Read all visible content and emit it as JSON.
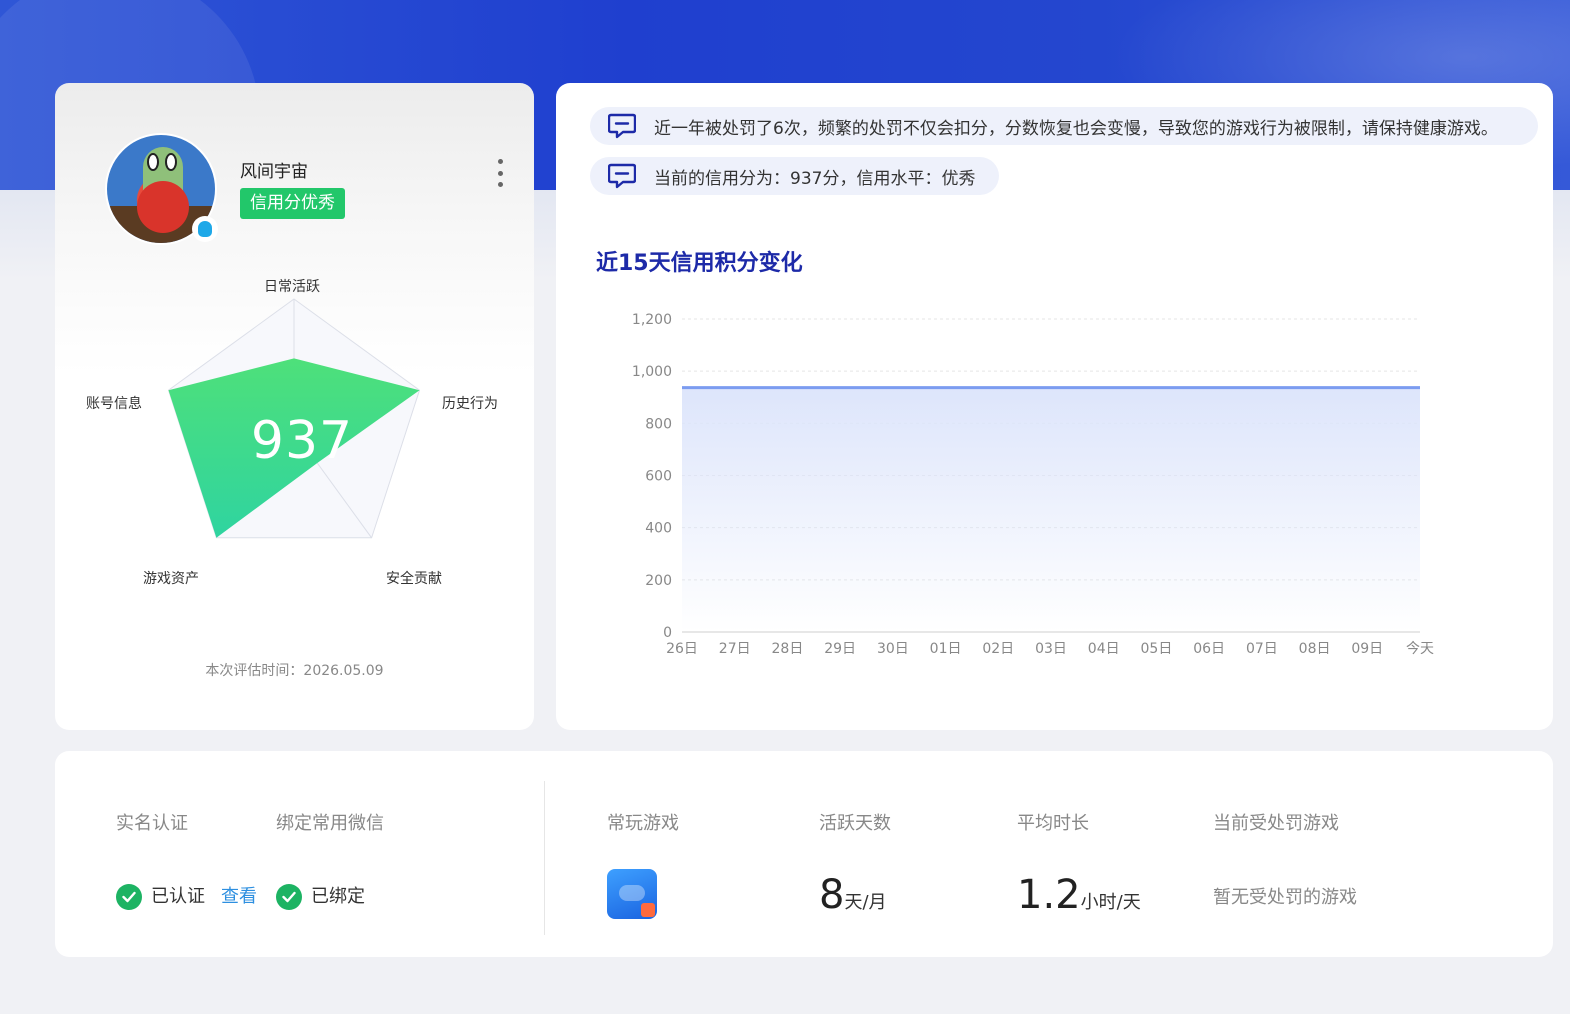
{
  "profile": {
    "nickname": "风间宇宙",
    "credit_badge": "信用分优秀",
    "score": "937",
    "radar_labels": {
      "daily": "日常活跃",
      "history": "历史行为",
      "security": "安全贡献",
      "assets": "游戏资产",
      "account": "账号信息"
    },
    "radar_values": {
      "daily": 0.55,
      "history": 1.0,
      "security": 0.3,
      "assets": 1.0,
      "account": 1.0
    },
    "eval_time": "本次评估时间：2026.05.09"
  },
  "notices": [
    "近一年被处罚了6次，频繁的处罚不仅会扣分，分数恢复也会变慢，导致您的游戏行为被限制，请保持健康游戏。",
    "当前的信用分为：937分，信用水平：优秀"
  ],
  "chart_data": {
    "type": "area",
    "title": "近15天信用积分变化",
    "x": [
      "26日",
      "27日",
      "28日",
      "29日",
      "30日",
      "01日",
      "02日",
      "03日",
      "04日",
      "05日",
      "06日",
      "07日",
      "08日",
      "09日",
      "今天"
    ],
    "y_tick_labels": [
      "0",
      "200",
      "400",
      "600",
      "800",
      "1,000",
      "1,200"
    ],
    "series": [
      {
        "values": [
          937,
          937,
          937,
          937,
          937,
          937,
          937,
          937,
          937,
          937,
          937,
          937,
          937,
          937,
          937
        ]
      }
    ],
    "ylim": [
      0,
      1200
    ],
    "grid": true,
    "line_color": "#7b9cf0",
    "fill_color": "#dde5fb"
  },
  "summary": {
    "realname_label": "实名认证",
    "wechat_label": "绑定常用微信",
    "realname_status": "已认证",
    "view_link": "查看",
    "wechat_status": "已绑定",
    "frequent_games_label": "常玩游戏",
    "active_days_label": "活跃天数",
    "avg_duration_label": "平均时长",
    "penalized_games_label": "当前受处罚游戏",
    "active_days_value": "8",
    "active_days_unit": "天/月",
    "avg_duration_value": "1.2",
    "avg_duration_unit": "小时/天",
    "penalized_games_value": "暂无受处罚的游戏"
  },
  "colors": {
    "primary_blue": "#1f3fcf",
    "success_green": "#22c76a",
    "radar_green": "#3cd87a",
    "link_blue": "#2d8fe0",
    "title_blue": "#1d2aa8"
  },
  "icons": {
    "more": "more-vertical-icon",
    "notice": "message-icon",
    "check": "check-circle-icon",
    "qq": "qq-penguin-icon"
  }
}
